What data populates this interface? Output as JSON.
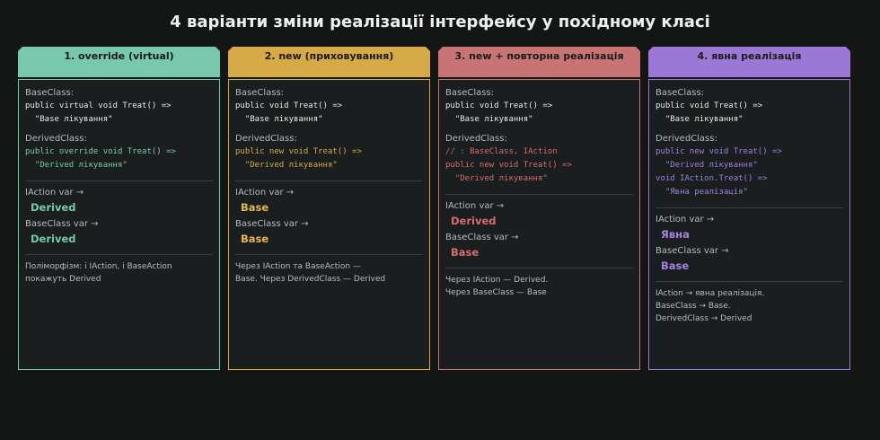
{
  "title": "4 варіанти зміни реалізації інтерфейсу у похідному класі",
  "colors": {
    "teal": "#77c8ac",
    "gold": "#d6aa46",
    "red": "#c87474",
    "purple": "#9c78d6"
  },
  "columns": [
    {
      "header": "1. override (virtual)",
      "base_label": "BaseClass:",
      "base_code": [
        "public virtual void Treat() =>",
        "  \"Base лікування\""
      ],
      "derived_label": "DerivedClass:",
      "derived_code": [
        "public override void Treat() =>",
        "  \"Derived лікування\""
      ],
      "iaction_label": "IAction var →",
      "iaction_result": "Derived",
      "baseclass_label": "BaseClass var →",
      "baseclass_result": "Derived",
      "note": [
        "Поліморфізм: і IAction, і BaseAction",
        "покажуть Derived"
      ]
    },
    {
      "header": "2. new (приховування)",
      "base_label": "BaseClass:",
      "base_code": [
        "public void Treat() =>",
        "  \"Base лікування\""
      ],
      "derived_label": "DerivedClass:",
      "derived_code": [
        "public new void Treat() =>",
        "  \"Derived лікування\""
      ],
      "iaction_label": "IAction var →",
      "iaction_result": "Base",
      "baseclass_label": "BaseClass var →",
      "baseclass_result": "Base",
      "note": [
        "Через IAction та BaseAction —",
        "Base. Через DerivedClass — Derived"
      ]
    },
    {
      "header": "3. new + повторна реалізація",
      "base_label": "BaseClass:",
      "base_code": [
        "public void Treat() =>",
        "  \"Base лікування\""
      ],
      "derived_label": "DerivedClass:",
      "derived_code": [
        "// : BaseClass, IAction",
        "public new void Treat() =>",
        "  \"Derived лікування\""
      ],
      "iaction_label": "IAction var →",
      "iaction_result": "Derived",
      "baseclass_label": "BaseClass var →",
      "baseclass_result": "Base",
      "note": [
        "Через IAction — Derived.",
        "Через BaseClass — Base"
      ]
    },
    {
      "header": "4. явна реалізація",
      "base_label": "BaseClass:",
      "base_code": [
        "public void Treat() =>",
        "  \"Base лікування\""
      ],
      "derived_label": "DerivedClass:",
      "derived_code": [
        "public new void Treat() =>",
        "  \"Derived лікування\"",
        "void IAction.Treat() =>",
        "  \"Явна реалізація\""
      ],
      "iaction_label": "IAction var →",
      "iaction_result": "Явна",
      "baseclass_label": "BaseClass var →",
      "baseclass_result": "Base",
      "note": [
        "IAction → явна реалізація.",
        "BaseClass → Base.",
        "DerivedClass → Derived"
      ]
    }
  ]
}
